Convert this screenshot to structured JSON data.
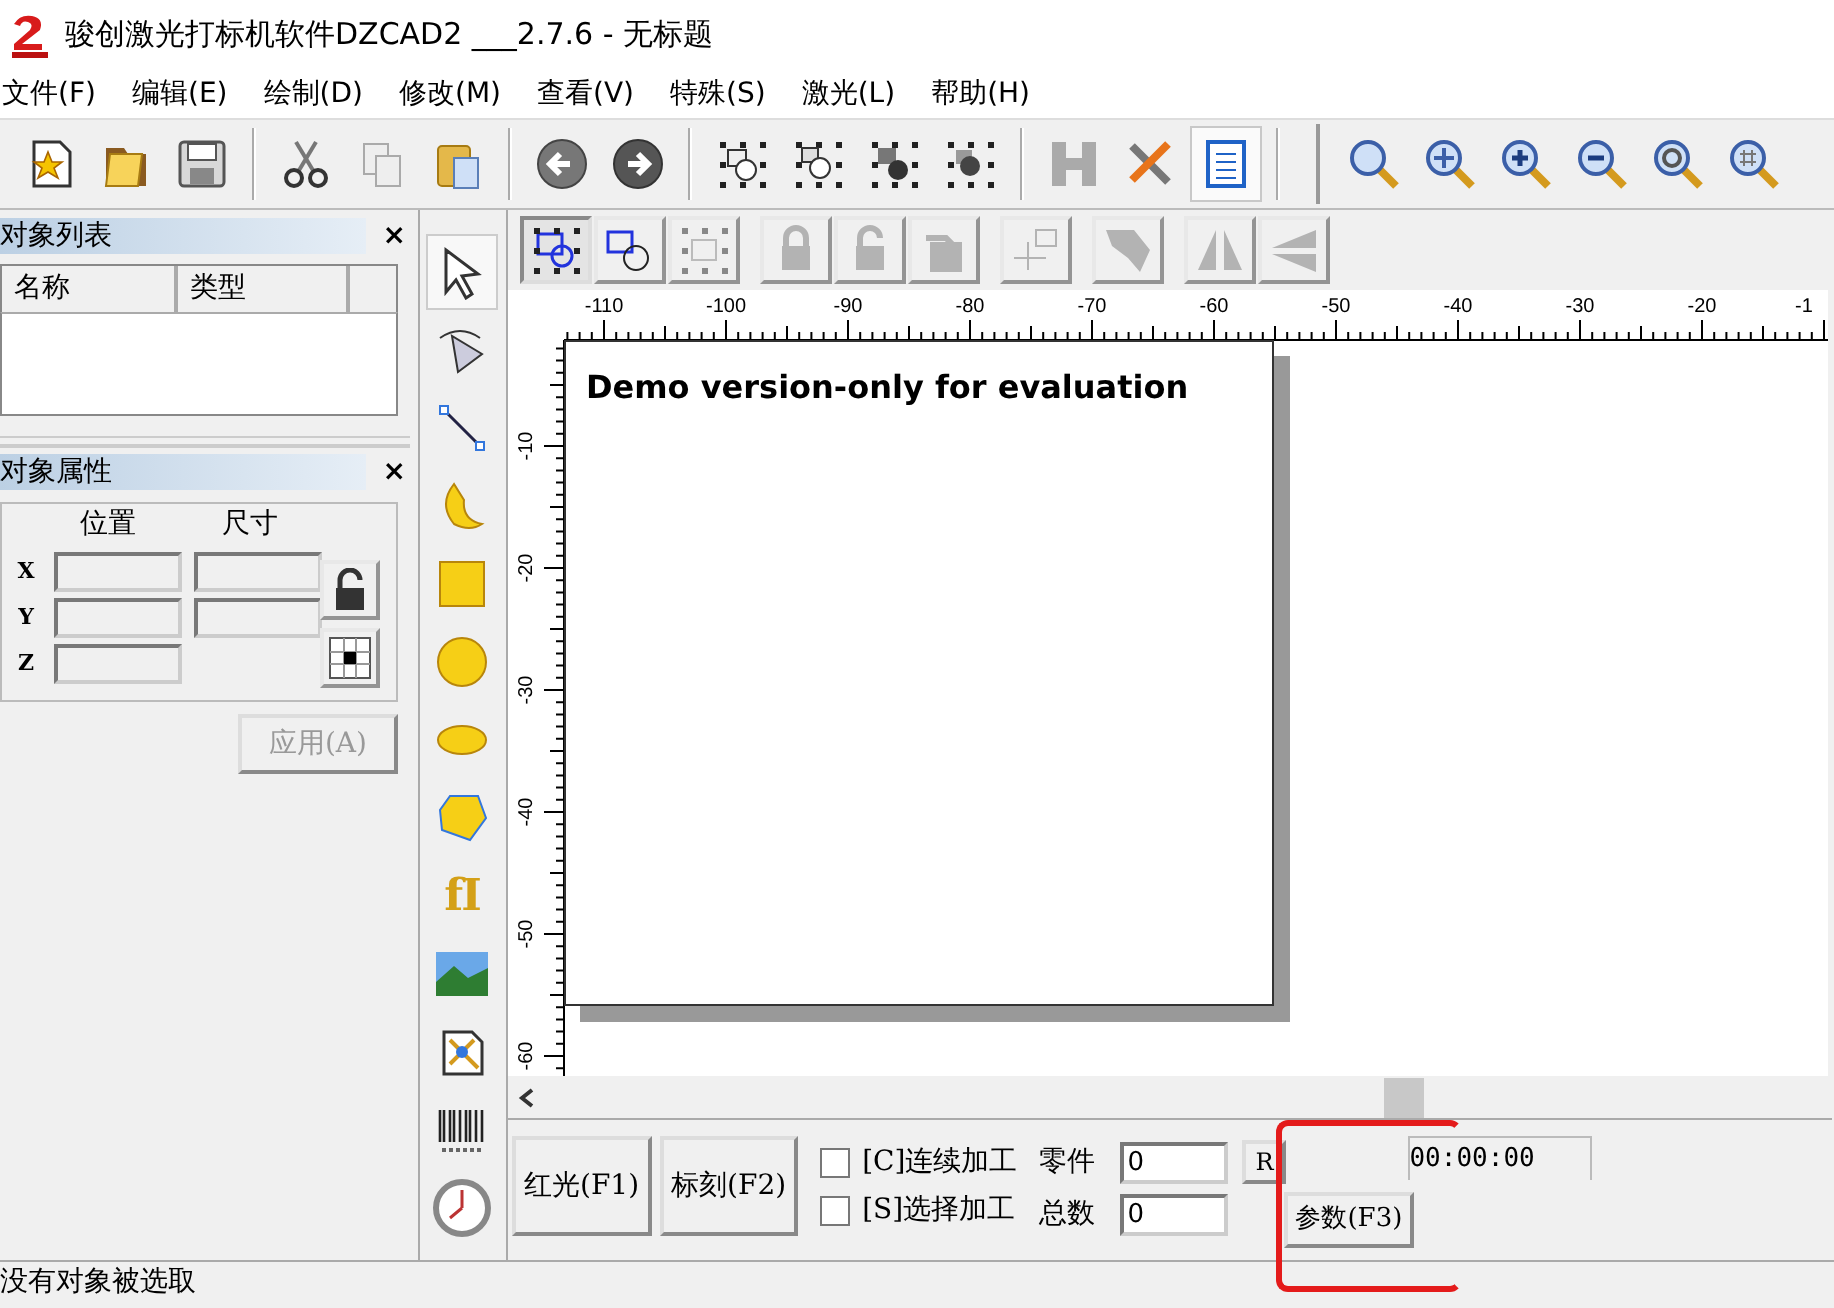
{
  "window": {
    "title": "骏创激光打标机软件DZCAD2 ___2.7.6 - 无标题"
  },
  "menu": [
    "文件(F)",
    "编辑(E)",
    "绘制(D)",
    "修改(M)",
    "查看(V)",
    "特殊(S)",
    "激光(L)",
    "帮助(H)"
  ],
  "toolbar": [
    {
      "kind": "new",
      "selected": false
    },
    {
      "kind": "open",
      "selected": false
    },
    {
      "kind": "save",
      "selected": false
    },
    {
      "kind": "cut",
      "selected": false
    },
    {
      "kind": "copy",
      "selected": false
    },
    {
      "kind": "paste",
      "selected": false
    },
    {
      "kind": "back",
      "selected": false
    },
    {
      "kind": "forward",
      "selected": false
    },
    {
      "kind": "nodes-a",
      "selected": false
    },
    {
      "kind": "nodes-b",
      "selected": false
    },
    {
      "kind": "nodes-c",
      "selected": false
    },
    {
      "kind": "nodes-d",
      "selected": false
    },
    {
      "kind": "hatch",
      "selected": false
    },
    {
      "kind": "tools",
      "selected": false
    },
    {
      "kind": "list",
      "selected": true
    },
    {
      "kind": "zoom",
      "selected": false
    },
    {
      "kind": "zoom-move",
      "selected": false
    },
    {
      "kind": "zoom-in",
      "selected": false
    },
    {
      "kind": "zoom-out",
      "selected": false
    },
    {
      "kind": "zoom-all",
      "selected": false
    },
    {
      "kind": "zoom-grid",
      "selected": false
    }
  ],
  "object_list": {
    "title": "对象列表",
    "close_button": "×",
    "columns": [
      "名称",
      "类型"
    ]
  },
  "object_properties": {
    "title": "对象属性",
    "close_button": "×",
    "headers": [
      "位置",
      "尺寸"
    ],
    "axes": [
      "X",
      "Y",
      "Z"
    ],
    "apply_button": {
      "label": "应用(A)",
      "disabled": true
    }
  },
  "draw_tools": [
    {
      "kind": "pointer",
      "selected": true
    },
    {
      "kind": "curve",
      "selected": false
    },
    {
      "kind": "line",
      "selected": false
    },
    {
      "kind": "crescent",
      "selected": false
    },
    {
      "kind": "rectangle",
      "selected": false
    },
    {
      "kind": "circle",
      "selected": false
    },
    {
      "kind": "ellipse",
      "selected": false
    },
    {
      "kind": "polygon",
      "selected": false
    },
    {
      "kind": "text",
      "label": "fI",
      "selected": false
    },
    {
      "kind": "image",
      "selected": false
    },
    {
      "kind": "vector",
      "selected": false
    },
    {
      "kind": "barcode",
      "selected": false
    },
    {
      "kind": "clock",
      "selected": false
    }
  ],
  "edit_toolbar": [
    {
      "kind": "group",
      "selected": true,
      "disabled": false
    },
    {
      "kind": "ungroup",
      "selected": false,
      "disabled": false
    },
    {
      "kind": "frame",
      "selected": false,
      "disabled": true
    },
    {
      "kind": "lock",
      "selected": false,
      "disabled": true
    },
    {
      "kind": "unlock",
      "selected": false,
      "disabled": true
    },
    {
      "kind": "lock-all",
      "selected": false,
      "disabled": true
    },
    {
      "kind": "origin",
      "selected": false,
      "disabled": true
    },
    {
      "kind": "shear",
      "selected": false,
      "disabled": true
    },
    {
      "kind": "mirror-h",
      "selected": false,
      "disabled": true
    },
    {
      "kind": "mirror-v",
      "selected": false,
      "disabled": true
    }
  ],
  "canvas": {
    "demo_notice": "Demo version-only for evaluation",
    "top_ruler": [
      "-110",
      "-100",
      "-90",
      "-80",
      "-70",
      "-60",
      "-50",
      "-40",
      "-30",
      "-20",
      "-1"
    ],
    "left_ruler": [
      "-10",
      "-20",
      "-30",
      "-40",
      "-50",
      "-60"
    ]
  },
  "controls": {
    "red_light_button": "红光(F1)",
    "mark_button": "标刻(F2)",
    "options": [
      {
        "label": "[C]连续加工",
        "checked": false
      },
      {
        "label": "[S]选择加工",
        "checked": false
      }
    ],
    "counters": [
      {
        "label": "零件",
        "value": "0"
      },
      {
        "label": "总数",
        "value": "0"
      }
    ],
    "reset_button": "R",
    "params_button": "参数(F3)",
    "timer": "00:00:00"
  },
  "status_bar": "没有对象被选取"
}
